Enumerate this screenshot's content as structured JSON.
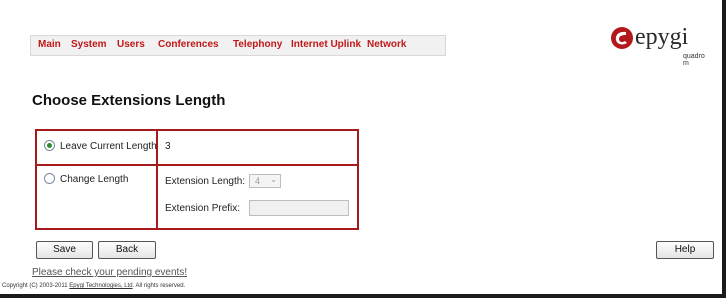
{
  "menu": [
    "Main",
    "System",
    "Users",
    "Conferences",
    "Telephony",
    "Internet Uplink",
    "Network"
  ],
  "logo": {
    "name": "epygi",
    "sub": "quadro m",
    "brand_color": "#b3191c",
    "icon": "epygi-logo-icon"
  },
  "page_title": "Choose Extensions Length",
  "options": {
    "leave": {
      "label": "Leave Current Length",
      "selected": true,
      "current_value": "3"
    },
    "change": {
      "label": "Change Length",
      "selected": false,
      "ext_length_label": "Extension Length:",
      "ext_length_value": "4",
      "ext_prefix_label": "Extension Prefix:",
      "ext_prefix_value": ""
    }
  },
  "buttons": {
    "save": "Save",
    "back": "Back",
    "help": "Help"
  },
  "pending_link": "Please check your pending events!",
  "copyright": {
    "pre": "Copyright (C) 2003-2011 ",
    "company": "Epygi Technologies, Ltd",
    "post": ". All rights reserved."
  },
  "colors": {
    "menu_text": "#c01818",
    "table_border": "#a51a1a",
    "radio_on": "#2e8b2e"
  }
}
